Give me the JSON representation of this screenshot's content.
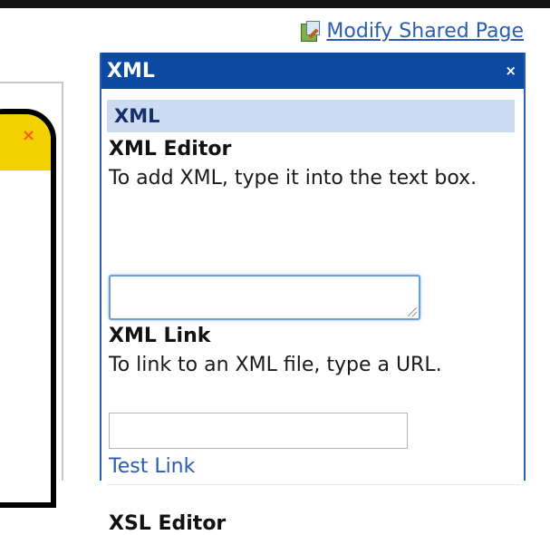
{
  "header": {
    "modify_shared_page": "Modify Shared Page",
    "modify_icon": "edit-page-icon"
  },
  "background_webpart": {
    "close_glyph": "×",
    "accent_color": "#f3d100"
  },
  "tool_pane": {
    "title": "XML",
    "close_glyph": "×",
    "section_title": "XML",
    "xml_editor": {
      "label": "XML Editor",
      "description": "To add XML, type it into the text box.",
      "value": ""
    },
    "xml_link": {
      "label": "XML Link",
      "description": "To link to an XML file, type a URL.",
      "value": "",
      "test_link": "Test Link"
    },
    "xsl_editor": {
      "label": "XSL Editor"
    },
    "colors": {
      "header_bg": "#0b49a2",
      "section_bg": "#cddcf2",
      "link": "#2a5db0"
    }
  }
}
